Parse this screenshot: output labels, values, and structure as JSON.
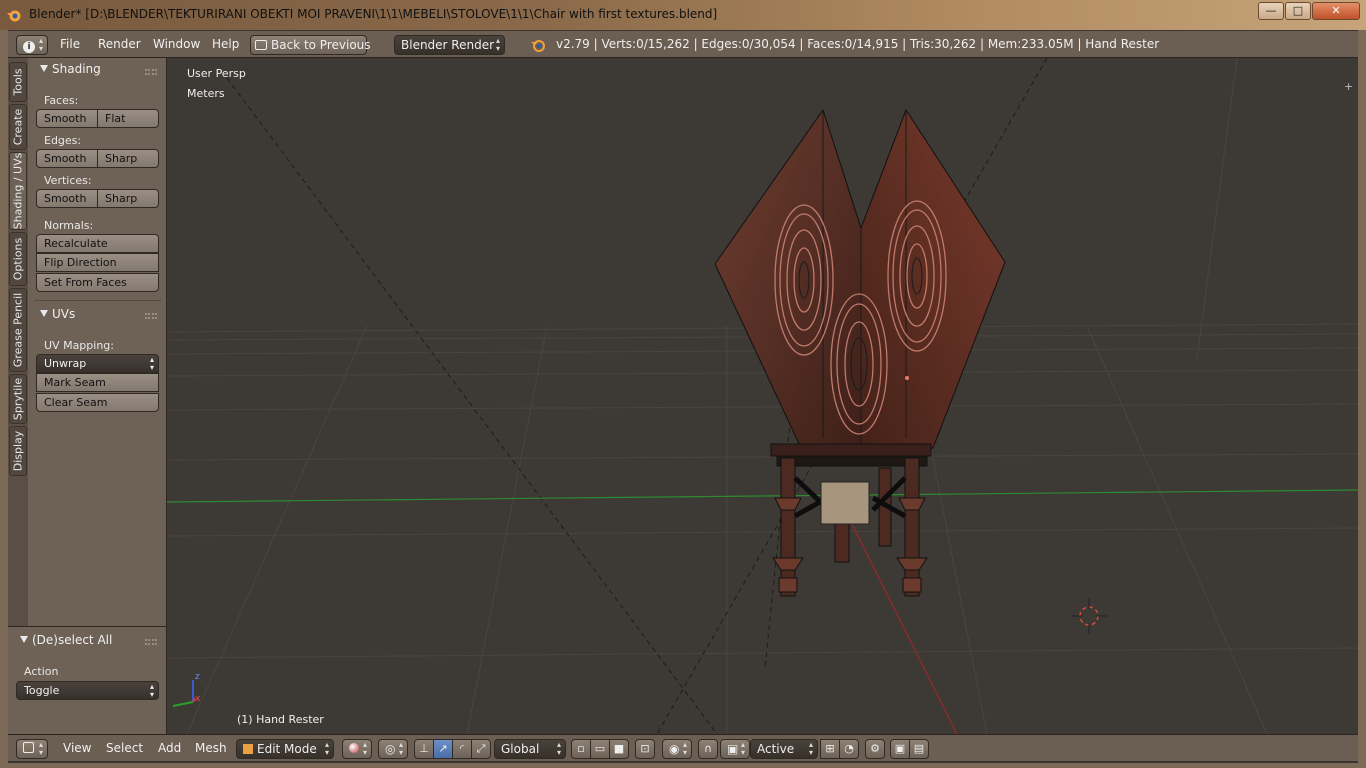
{
  "window": {
    "title": "Blender* [D:\\BLENDER\\TEKTURIRANI OBEKTI MOI PRAVENI\\1\\1\\MEBELI\\STOLOVE\\1\\1\\Chair with first textures.blend]",
    "controls": {
      "minimize": "—",
      "maximize": "□",
      "close": "✕"
    }
  },
  "header": {
    "menus": [
      "File",
      "Render",
      "Window",
      "Help"
    ],
    "back_button": "Back to Previous",
    "render_engine": "Blender Render",
    "stats": "v2.79 | Verts:0/15,262 | Edges:0/30,054 | Faces:0/14,915 | Tris:30,262 | Mem:233.05M | Hand Rester",
    "editor_icon": "info-icon"
  },
  "tabs": [
    "Tools",
    "Create",
    "Shading / UVs",
    "Options",
    "Grease Pencil",
    "Sprytile",
    "Display"
  ],
  "shading_panel": {
    "title": "Shading",
    "faces_label": "Faces:",
    "faces_smooth": "Smooth",
    "faces_flat": "Flat",
    "edges_label": "Edges:",
    "edges_smooth": "Smooth",
    "edges_sharp": "Sharp",
    "vertices_label": "Vertices:",
    "vertices_smooth": "Smooth",
    "vertices_sharp": "Sharp",
    "normals_label": "Normals:",
    "recalculate": "Recalculate",
    "flip_direction": "Flip Direction",
    "set_from_faces": "Set From Faces"
  },
  "uvs_panel": {
    "title": "UVs",
    "uv_mapping_label": "UV Mapping:",
    "unwrap": "Unwrap",
    "mark_seam": "Mark Seam",
    "clear_seam": "Clear Seam"
  },
  "operator_panel": {
    "title": "(De)select All",
    "action_label": "Action",
    "action_value": "Toggle"
  },
  "viewport": {
    "view_name": "User Persp",
    "units": "Meters",
    "object_info": "(1) Hand Rester",
    "axis_z": "z",
    "axis_x": "x",
    "plus": "+"
  },
  "footer": {
    "menus": [
      "View",
      "Select",
      "Add",
      "Mesh"
    ],
    "mode": "Edit Mode",
    "orientation": "Global",
    "pivot_active": "Active"
  },
  "colors": {
    "viewport_bg": "#3d3935",
    "panel_bg": "#6e6256",
    "header_bg": "#6b5e52",
    "x_axis": "#9a2a2a",
    "y_axis": "#2e8a2e",
    "chair_wood": "#5a2f25",
    "active_button": "#4a6ea8"
  }
}
